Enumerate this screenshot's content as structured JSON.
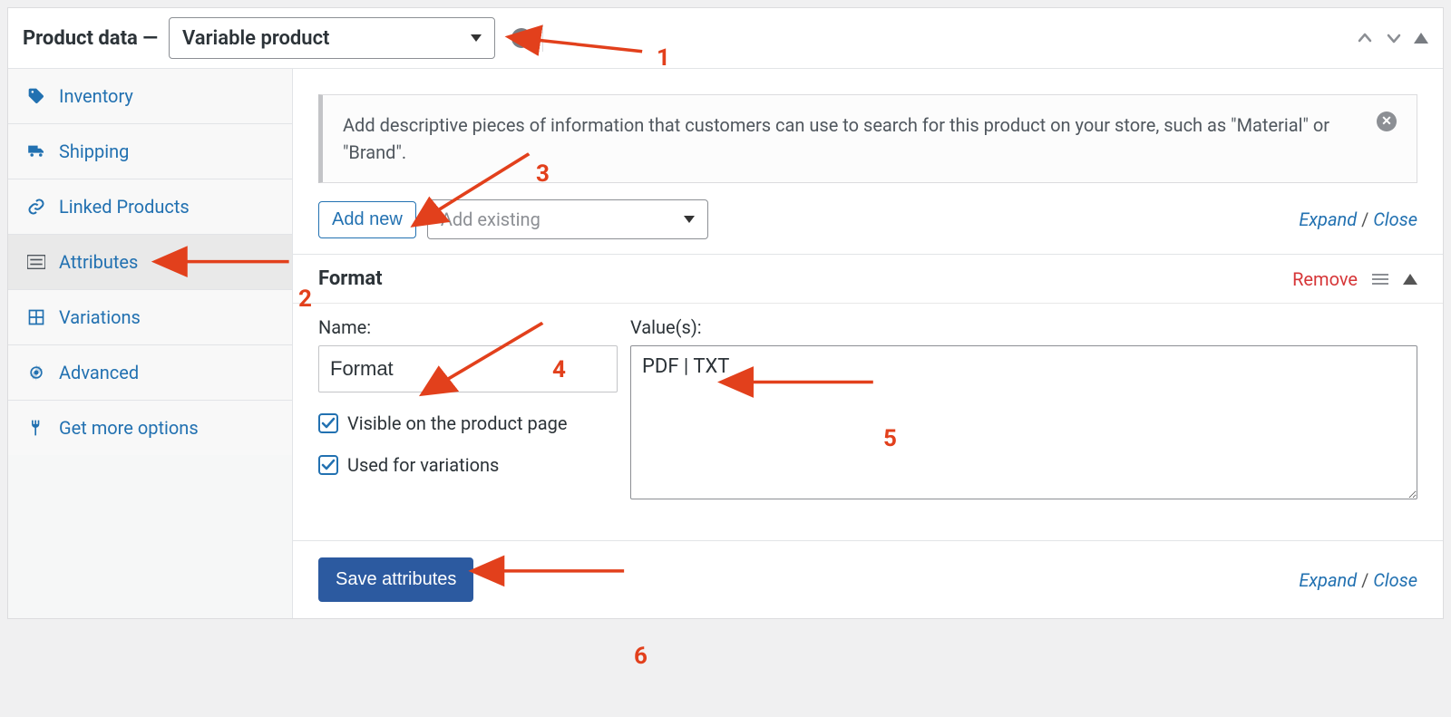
{
  "header": {
    "title": "Product data —",
    "product_type": "Variable product"
  },
  "sidebar": {
    "items": [
      {
        "label": "Inventory"
      },
      {
        "label": "Shipping"
      },
      {
        "label": "Linked Products"
      },
      {
        "label": "Attributes"
      },
      {
        "label": "Variations"
      },
      {
        "label": "Advanced"
      },
      {
        "label": "Get more options"
      }
    ]
  },
  "info": {
    "text": "Add descriptive pieces of information that customers can use to search for this product on your store, such as \"Material\" or \"Brand\"."
  },
  "toolbar": {
    "add_new": "Add new",
    "add_existing_placeholder": "Add existing",
    "expand": "Expand",
    "close": "Close"
  },
  "attribute": {
    "title": "Format",
    "remove": "Remove",
    "name_label": "Name:",
    "name_value": "Format",
    "values_label": "Value(s):",
    "values_value": "PDF | TXT",
    "visible_label": "Visible on the product page",
    "variations_label": "Used for variations",
    "visible_checked": true,
    "variations_checked": true
  },
  "footer": {
    "save": "Save attributes",
    "expand": "Expand",
    "close": "Close"
  },
  "annotations": [
    "1",
    "2",
    "3",
    "4",
    "5",
    "6"
  ]
}
